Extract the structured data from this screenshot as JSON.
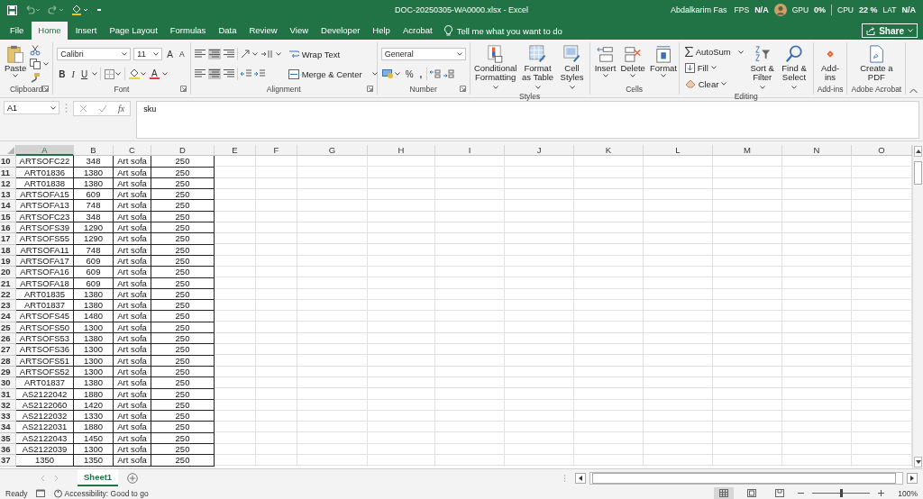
{
  "title_bar": {
    "document_title": "DOC-20250305-WA0000.xlsx  -  Excel",
    "account_name": "Abdalkarim Fas",
    "overlay": [
      {
        "label": "FPS",
        "value": "N/A"
      },
      {
        "label": "GPU",
        "value": "0%"
      },
      {
        "label": "CPU",
        "value": "22 %"
      },
      {
        "label": "LAT",
        "value": "N/A"
      }
    ]
  },
  "ribbon_tabs": [
    {
      "label": "File",
      "selected": false
    },
    {
      "label": "Home",
      "selected": true
    },
    {
      "label": "Insert",
      "selected": false
    },
    {
      "label": "Page Layout",
      "selected": false
    },
    {
      "label": "Formulas",
      "selected": false
    },
    {
      "label": "Data",
      "selected": false
    },
    {
      "label": "Review",
      "selected": false
    },
    {
      "label": "View",
      "selected": false
    },
    {
      "label": "Developer",
      "selected": false
    },
    {
      "label": "Help",
      "selected": false
    },
    {
      "label": "Acrobat",
      "selected": false
    }
  ],
  "tell_me": "Tell me what you want to do",
  "share": "Share",
  "ribbon": {
    "groups": [
      {
        "label": "Clipboard",
        "commands": [
          "Paste"
        ]
      },
      {
        "label": "Font",
        "font_name": "Calibri",
        "font_size": "11",
        "commands": [
          "A",
          "A",
          "B",
          "I",
          "U",
          "A"
        ]
      },
      {
        "label": "Alignment",
        "commands": [
          "Wrap Text",
          "Merge & Center"
        ]
      },
      {
        "label": "Number",
        "format": "General",
        "commands": [
          "%",
          ","
        ]
      },
      {
        "label": "Styles",
        "commands": [
          "Conditional Formatting",
          "Format as Table",
          "Cell Styles"
        ]
      },
      {
        "label": "Cells",
        "commands": [
          "Insert",
          "Delete",
          "Format"
        ]
      },
      {
        "label": "Editing",
        "commands": [
          "AutoSum",
          "Fill",
          "Clear",
          "Sort & Filter",
          "Find & Select"
        ]
      },
      {
        "label": "Add-ins",
        "commands": [
          "Add-ins"
        ]
      },
      {
        "label": "Adobe Acrobat",
        "commands": [
          "Create a PDF"
        ]
      }
    ]
  },
  "formula_bar": {
    "name_box": "A1",
    "function_label": "fx",
    "formula": "sku"
  },
  "sheet": {
    "columns": [
      {
        "label": "A",
        "selected": true
      },
      {
        "label": "B",
        "selected": false
      },
      {
        "label": "C",
        "selected": false
      },
      {
        "label": "D",
        "selected": false
      },
      {
        "label": "E",
        "selected": false
      },
      {
        "label": "F",
        "selected": false
      },
      {
        "label": "G",
        "selected": false
      },
      {
        "label": "H",
        "selected": false
      },
      {
        "label": "I",
        "selected": false
      },
      {
        "label": "J",
        "selected": false
      },
      {
        "label": "K",
        "selected": false
      },
      {
        "label": "L",
        "selected": false
      },
      {
        "label": "M",
        "selected": false
      },
      {
        "label": "N",
        "selected": false
      },
      {
        "label": "O",
        "selected": false
      }
    ],
    "rows": [
      {
        "number": "10",
        "cells": [
          "ARTSOFC22",
          "348",
          "Art sofa",
          "250"
        ]
      },
      {
        "number": "11",
        "cells": [
          "ART01836",
          "1380",
          "Art sofa",
          "250"
        ]
      },
      {
        "number": "12",
        "cells": [
          "ART01838",
          "1380",
          "Art sofa",
          "250"
        ]
      },
      {
        "number": "13",
        "cells": [
          "ARTSOFA15",
          "609",
          "Art sofa",
          "250"
        ]
      },
      {
        "number": "14",
        "cells": [
          "ARTSOFA13",
          "748",
          "Art sofa",
          "250"
        ]
      },
      {
        "number": "15",
        "cells": [
          "ARTSOFC23",
          "348",
          "Art sofa",
          "250"
        ]
      },
      {
        "number": "16",
        "cells": [
          "ARTSOFS39",
          "1290",
          "Art sofa",
          "250"
        ]
      },
      {
        "number": "17",
        "cells": [
          "ARTSOFS55",
          "1290",
          "Art sofa",
          "250"
        ]
      },
      {
        "number": "18",
        "cells": [
          "ARTSOFA11",
          "748",
          "Art sofa",
          "250"
        ]
      },
      {
        "number": "19",
        "cells": [
          "ARTSOFA17",
          "609",
          "Art sofa",
          "250"
        ]
      },
      {
        "number": "20",
        "cells": [
          "ARTSOFA16",
          "609",
          "Art sofa",
          "250"
        ]
      },
      {
        "number": "21",
        "cells": [
          "ARTSOFA18",
          "609",
          "Art sofa",
          "250"
        ]
      },
      {
        "number": "22",
        "cells": [
          "ART01835",
          "1380",
          "Art sofa",
          "250"
        ]
      },
      {
        "number": "23",
        "cells": [
          "ART01837",
          "1380",
          "Art sofa",
          "250"
        ]
      },
      {
        "number": "24",
        "cells": [
          "ARTSOFS45",
          "1480",
          "Art sofa",
          "250"
        ]
      },
      {
        "number": "25",
        "cells": [
          "ARTSOFS50",
          "1300",
          "Art sofa",
          "250"
        ]
      },
      {
        "number": "26",
        "cells": [
          "ARTSOFS53",
          "1380",
          "Art sofa",
          "250"
        ]
      },
      {
        "number": "27",
        "cells": [
          "ARTSOFS36",
          "1300",
          "Art sofa",
          "250"
        ]
      },
      {
        "number": "28",
        "cells": [
          "ARTSOFS51",
          "1300",
          "Art sofa",
          "250"
        ]
      },
      {
        "number": "29",
        "cells": [
          "ARTSOFS52",
          "1300",
          "Art sofa",
          "250"
        ]
      },
      {
        "number": "30",
        "cells": [
          "ART01837",
          "1380",
          "Art sofa",
          "250"
        ]
      },
      {
        "number": "31",
        "cells": [
          "AS2122042",
          "1880",
          "Art sofa",
          "250"
        ]
      },
      {
        "number": "32",
        "cells": [
          "AS2122060",
          "1420",
          "Art sofa",
          "250"
        ]
      },
      {
        "number": "33",
        "cells": [
          "AS2122032",
          "1330",
          "Art sofa",
          "250"
        ]
      },
      {
        "number": "34",
        "cells": [
          "AS2122031",
          "1880",
          "Art sofa",
          "250"
        ]
      },
      {
        "number": "35",
        "cells": [
          "AS2122043",
          "1450",
          "Art sofa",
          "250"
        ]
      },
      {
        "number": "36",
        "cells": [
          "AS2122039",
          "1300",
          "Art sofa",
          "250"
        ]
      },
      {
        "number": "37",
        "cells": [
          "1350",
          "1350",
          "Art sofa",
          "250"
        ]
      }
    ]
  },
  "sheet_tabs": [
    {
      "label": "Sheet1",
      "selected": true
    }
  ],
  "status_bar": {
    "mode": "Ready",
    "accessibility": "Accessibility: Good to go",
    "view_modes": [
      {
        "selected": true
      },
      {
        "selected": false
      },
      {
        "selected": false
      }
    ],
    "zoom": {
      "level": 0.5
    },
    "zoom_label": "100%"
  }
}
